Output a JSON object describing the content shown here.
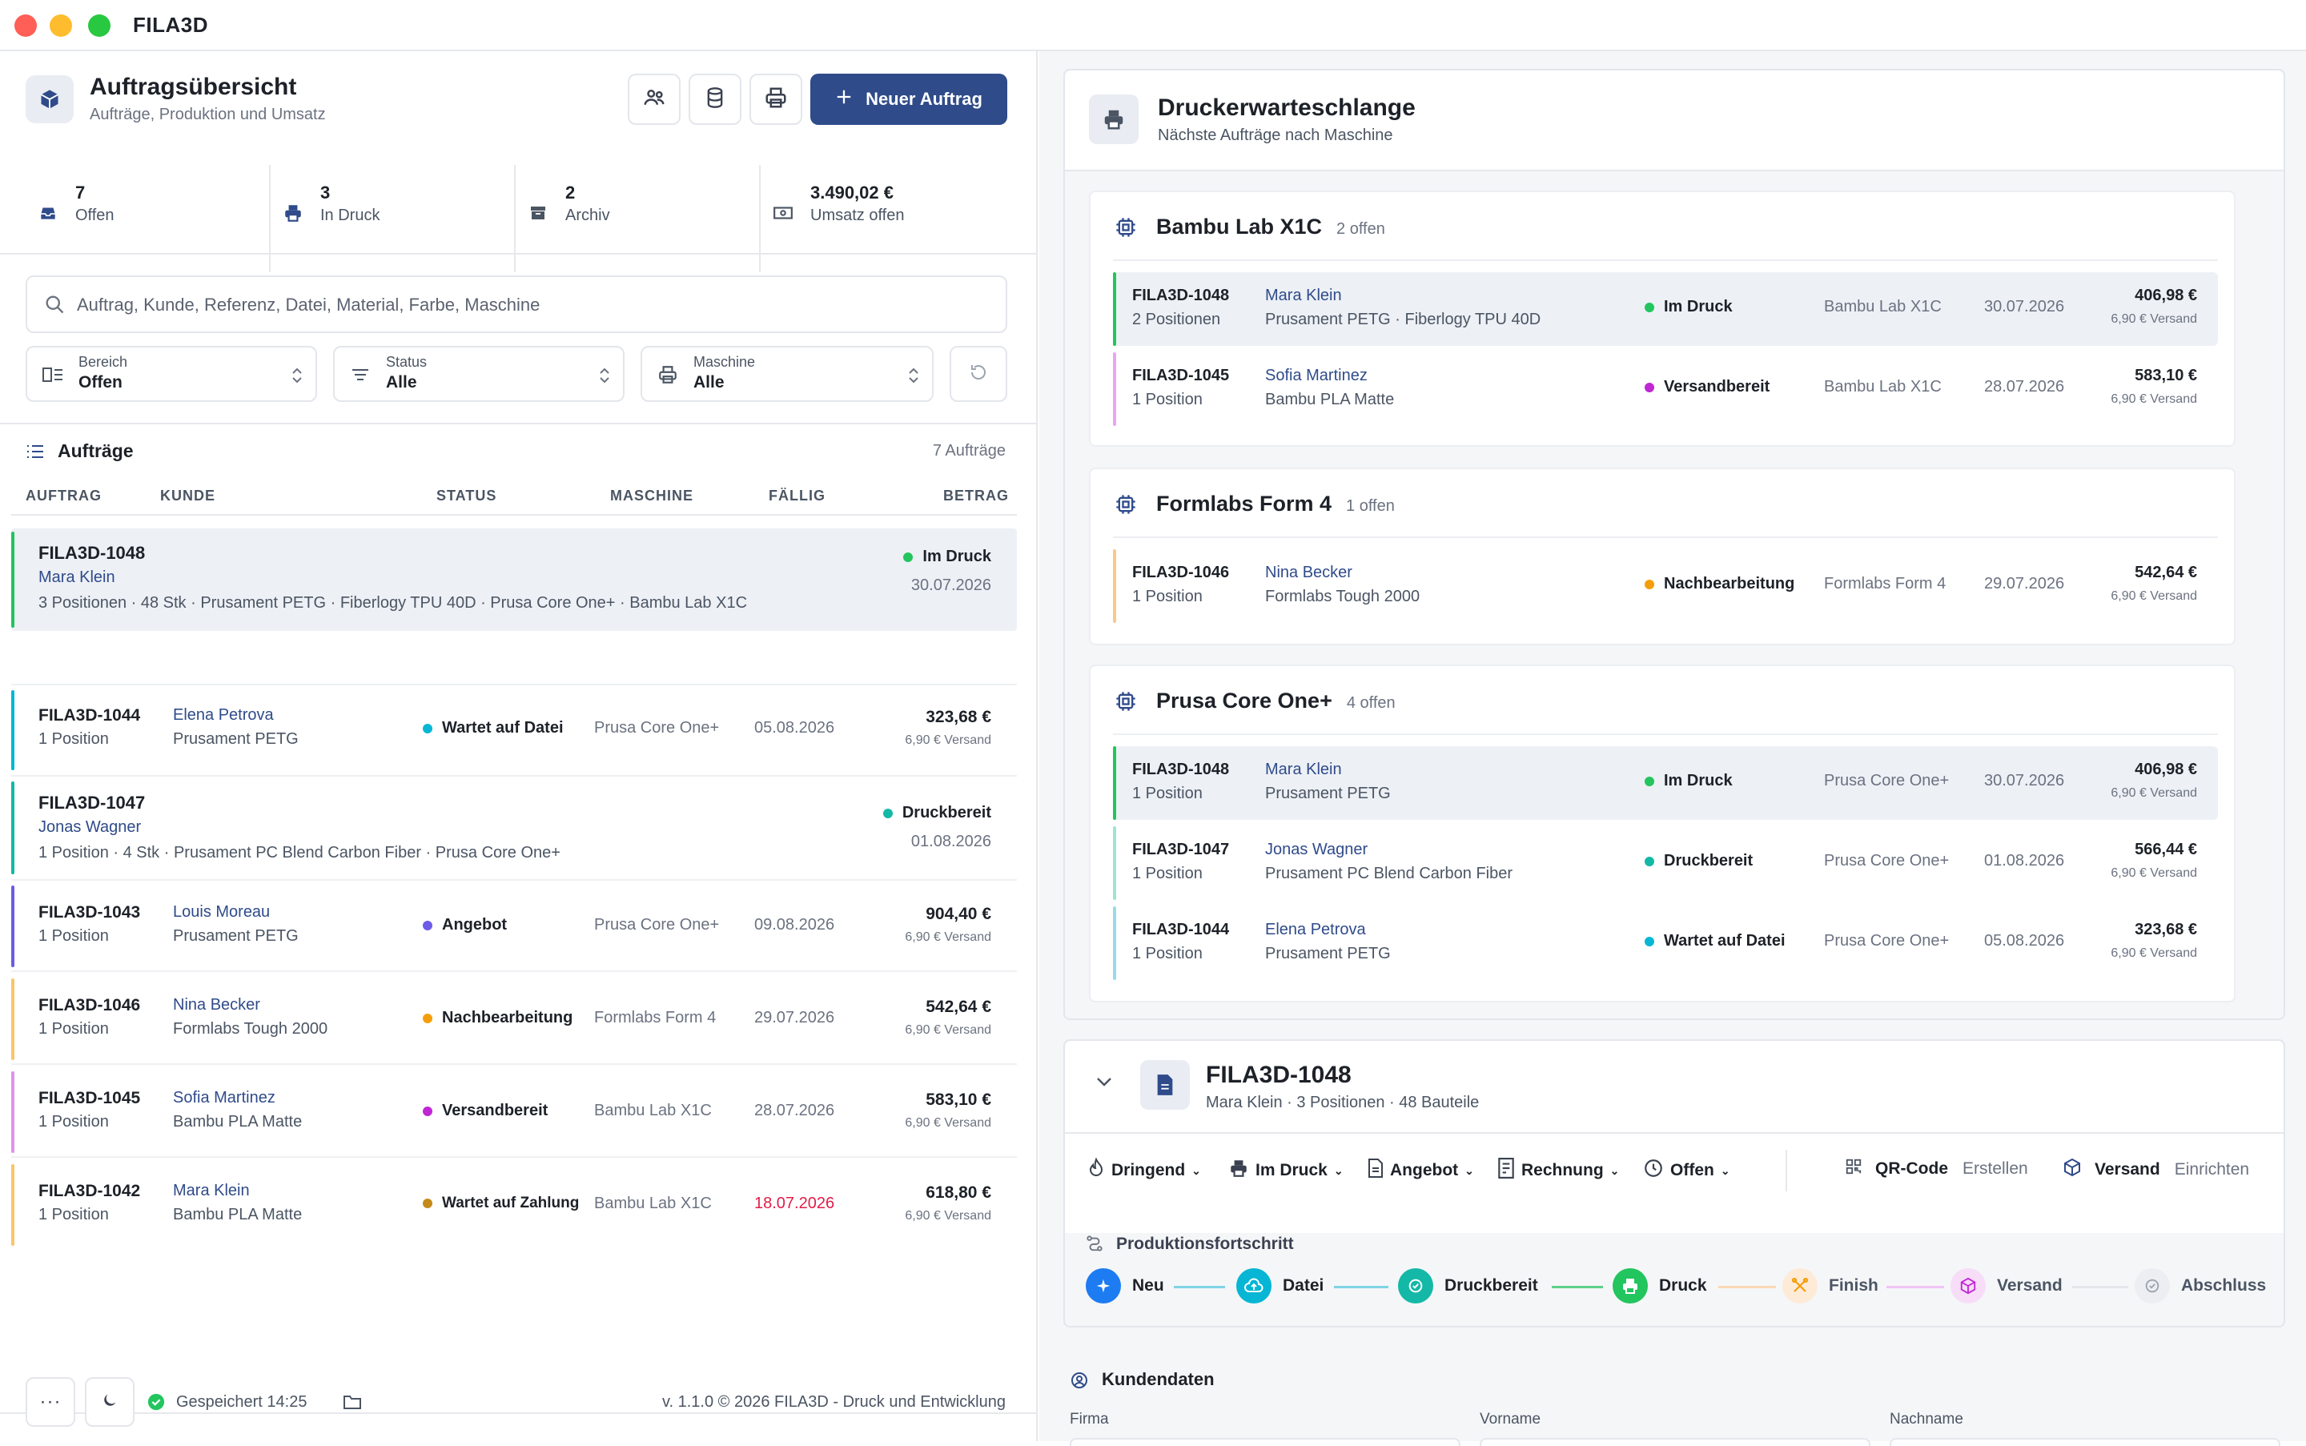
{
  "app": {
    "title": "FILA3D"
  },
  "header": {
    "title": "Auftragsübersicht",
    "subtitle": "Aufträge, Produktion und Umsatz",
    "new_order": "Neuer Auftrag"
  },
  "stats": [
    {
      "value": "7",
      "label": "Offen",
      "icon": "inbox-icon"
    },
    {
      "value": "3",
      "label": "In Druck",
      "icon": "printer-icon"
    },
    {
      "value": "2",
      "label": "Archiv",
      "icon": "archive-icon"
    },
    {
      "value": "3.490,02 €",
      "label": "Umsatz offen",
      "icon": "banknote-icon"
    }
  ],
  "search": {
    "placeholder": "Auftrag, Kunde, Referenz, Datei, Material, Farbe, Maschine"
  },
  "filters": [
    {
      "label": "Bereich",
      "value": "Offen"
    },
    {
      "label": "Status",
      "value": "Alle"
    },
    {
      "label": "Maschine",
      "value": "Alle"
    }
  ],
  "orders": {
    "title": "Aufträge",
    "count": "7 Aufträge",
    "columns": [
      "AUFTRAG",
      "KUNDE",
      "STATUS",
      "MASCHINE",
      "FÄLLIG",
      "BETRAG"
    ],
    "expanded1": {
      "id": "FILA3D-1048",
      "customer": "Mara Klein",
      "details": "3 Positionen · 48 Stk · Prusament PETG · Fiberlogy TPU 40D · Prusa Core One+ · Bambu Lab X1C",
      "status": "Im Druck",
      "due": "30.07.2026"
    },
    "expanded2": {
      "id": "FILA3D-1047",
      "customer": "Jonas Wagner",
      "details": "1 Position · 4 Stk · Prusament PC Blend Carbon Fiber · Prusa Core One+",
      "status": "Druckbereit",
      "due": "01.08.2026"
    },
    "rows": [
      {
        "id": "FILA3D-1044",
        "pos": "1 Position",
        "customer": "Elena Petrova",
        "material": "Prusament PETG",
        "status": "Wartet auf Datei",
        "machine": "Prusa Core One+",
        "due": "05.08.2026",
        "amount": "323,68 €",
        "shipping": "6,90 € Versand"
      },
      {
        "id": "FILA3D-1043",
        "pos": "1 Position",
        "customer": "Louis Moreau",
        "material": "Prusament PETG",
        "status": "Angebot",
        "machine": "Prusa Core One+",
        "due": "09.08.2026",
        "amount": "904,40 €",
        "shipping": "6,90 € Versand"
      },
      {
        "id": "FILA3D-1046",
        "pos": "1 Position",
        "customer": "Nina Becker",
        "material": "Formlabs Tough 2000",
        "status": "Nachbearbeitung",
        "machine": "Formlabs Form 4",
        "due": "29.07.2026",
        "amount": "542,64 €",
        "shipping": "6,90 € Versand"
      },
      {
        "id": "FILA3D-1045",
        "pos": "1 Position",
        "customer": "Sofia Martinez",
        "material": "Bambu PLA Matte",
        "status": "Versandbereit",
        "machine": "Bambu Lab X1C",
        "due": "28.07.2026",
        "amount": "583,10 €",
        "shipping": "6,90 € Versand"
      },
      {
        "id": "FILA3D-1042",
        "pos": "1 Position",
        "customer": "Mara Klein",
        "material": "Bambu PLA Matte",
        "status": "Wartet auf Zahlung",
        "machine": "Bambu Lab X1C",
        "due": "18.07.2026",
        "amount": "618,80 €",
        "shipping": "6,90 € Versand"
      }
    ]
  },
  "footer": {
    "saved": "Gespeichert 14:25",
    "version": "v. 1.1.0 © 2026 FILA3D - Druck und Entwicklung"
  },
  "queue": {
    "title": "Druckerwarteschlange",
    "subtitle": "Nächste Aufträge nach Maschine",
    "machines": [
      {
        "name": "Bambu Lab X1C",
        "count": "2 offen",
        "items": [
          {
            "id": "FILA3D-1048",
            "pos": "2 Positionen",
            "customer": "Mara Klein",
            "material": "Prusament PETG · Fiberlogy TPU 40D",
            "status": "Im Druck",
            "machine": "Bambu Lab X1C",
            "due": "30.07.2026",
            "amount": "406,98 €",
            "shipping": "6,90 € Versand"
          },
          {
            "id": "FILA3D-1045",
            "pos": "1 Position",
            "customer": "Sofia Martinez",
            "material": "Bambu PLA Matte",
            "status": "Versandbereit",
            "machine": "Bambu Lab X1C",
            "due": "28.07.2026",
            "amount": "583,10 €",
            "shipping": "6,90 € Versand"
          }
        ]
      },
      {
        "name": "Formlabs Form 4",
        "count": "1 offen",
        "items": [
          {
            "id": "FILA3D-1046",
            "pos": "1 Position",
            "customer": "Nina Becker",
            "material": "Formlabs Tough 2000",
            "status": "Nachbearbeitung",
            "machine": "Formlabs Form 4",
            "due": "29.07.2026",
            "amount": "542,64 €",
            "shipping": "6,90 € Versand"
          }
        ]
      },
      {
        "name": "Prusa Core One+",
        "count": "4 offen",
        "items": [
          {
            "id": "FILA3D-1048",
            "pos": "1 Position",
            "customer": "Mara Klein",
            "material": "Prusament PETG",
            "status": "Im Druck",
            "machine": "Prusa Core One+",
            "due": "30.07.2026",
            "amount": "406,98 €",
            "shipping": "6,90 € Versand"
          },
          {
            "id": "FILA3D-1047",
            "pos": "1 Position",
            "customer": "Jonas Wagner",
            "material": "Prusament PC Blend Carbon Fiber",
            "status": "Druckbereit",
            "machine": "Prusa Core One+",
            "due": "01.08.2026",
            "amount": "566,44 €",
            "shipping": "6,90 € Versand"
          },
          {
            "id": "FILA3D-1044",
            "pos": "1 Position",
            "customer": "Elena Petrova",
            "material": "Prusament PETG",
            "status": "Wartet auf Datei",
            "machine": "Prusa Core One+",
            "due": "05.08.2026",
            "amount": "323,68 €",
            "shipping": "6,90 € Versand"
          }
        ]
      }
    ]
  },
  "detail": {
    "id": "FILA3D-1048",
    "subtitle": "Mara Klein · 3 Positionen · 48 Bauteile",
    "chips": [
      "Dringend",
      "Im Druck",
      "Angebot",
      "Rechnung",
      "Offen"
    ],
    "qr": {
      "label": "QR-Code",
      "action": "Erstellen"
    },
    "ship": {
      "label": "Versand",
      "action": "Einrichten"
    },
    "progress_title": "Produktionsfortschritt",
    "steps": [
      "Neu",
      "Datei",
      "Druckbereit",
      "Druck",
      "Finish",
      "Versand",
      "Abschluss"
    ],
    "customer_title": "Kundendaten",
    "fields": [
      "Firma",
      "Vorname",
      "Nachname"
    ]
  },
  "colors": {
    "accent": "#2f4b8a",
    "green": "#22c55e",
    "cyan": "#06b6d4",
    "teal": "#14b8a6",
    "violet": "#6d5ce8",
    "orange": "#f59e0b",
    "magenta": "#c026d3",
    "mustard": "#c58a1a",
    "red": "#e11d48"
  }
}
